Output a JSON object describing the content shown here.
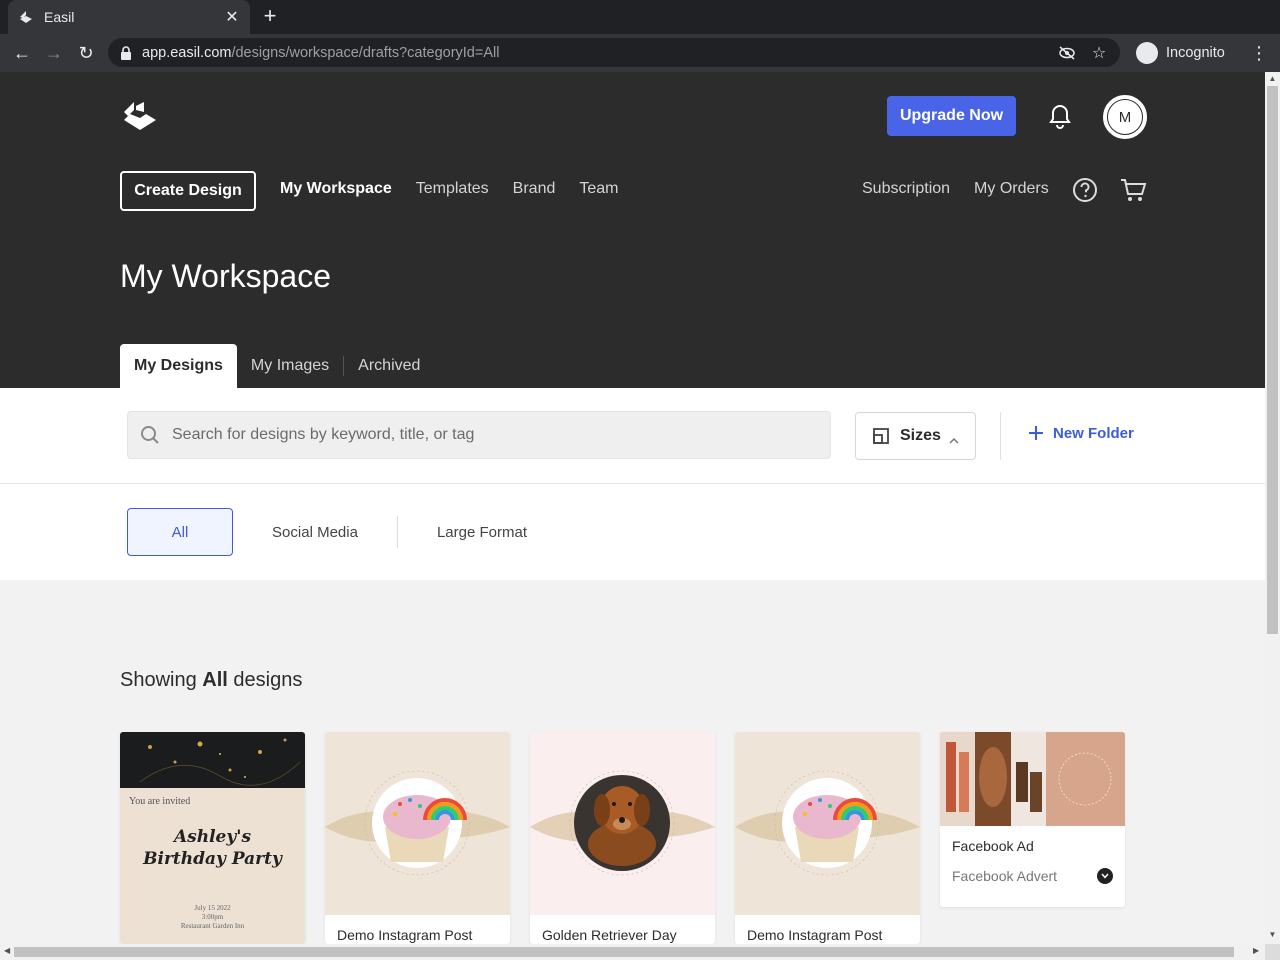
{
  "browser": {
    "tab_title": "Easil",
    "url_host": "app.easil.com",
    "url_path": "/designs/workspace/drafts?categoryId=All",
    "profile_label": "Incognito"
  },
  "header": {
    "upgrade_label": "Upgrade Now",
    "avatar_initial": "M",
    "create_label": "Create Design",
    "nav": [
      "My Workspace",
      "Templates",
      "Brand",
      "Team"
    ],
    "right_nav": [
      "Subscription",
      "My Orders"
    ],
    "page_title": "My Workspace",
    "subtabs": [
      "My Designs",
      "My Images",
      "Archived"
    ]
  },
  "search": {
    "placeholder": "Search for designs by keyword, title, or tag",
    "sizes_label": "Sizes",
    "new_folder_label": "New Folder"
  },
  "filters": [
    "All",
    "Social Media",
    "Large Format"
  ],
  "showing": {
    "prefix": "Showing",
    "bold": "All",
    "suffix": "designs"
  },
  "cards": [
    {
      "title": "",
      "subtitle": "",
      "invite_line": "You are invited",
      "headline_1": "Ashley's",
      "headline_2": "Birthday Party",
      "details_1": "July 15 2022",
      "details_2": "3:00pm",
      "details_3": "Restaurant Garden Inn"
    },
    {
      "title": "Demo Instagram Post",
      "subtitle": ""
    },
    {
      "title": "Golden Retriever Day",
      "subtitle": ""
    },
    {
      "title": "Demo Instagram Post",
      "subtitle": ""
    },
    {
      "title": "Facebook Ad",
      "subtitle": "Facebook Advert"
    }
  ],
  "colors": {
    "accent": "#4a64e8",
    "link": "#3d5be0",
    "header_bg": "#2c2c2c"
  }
}
